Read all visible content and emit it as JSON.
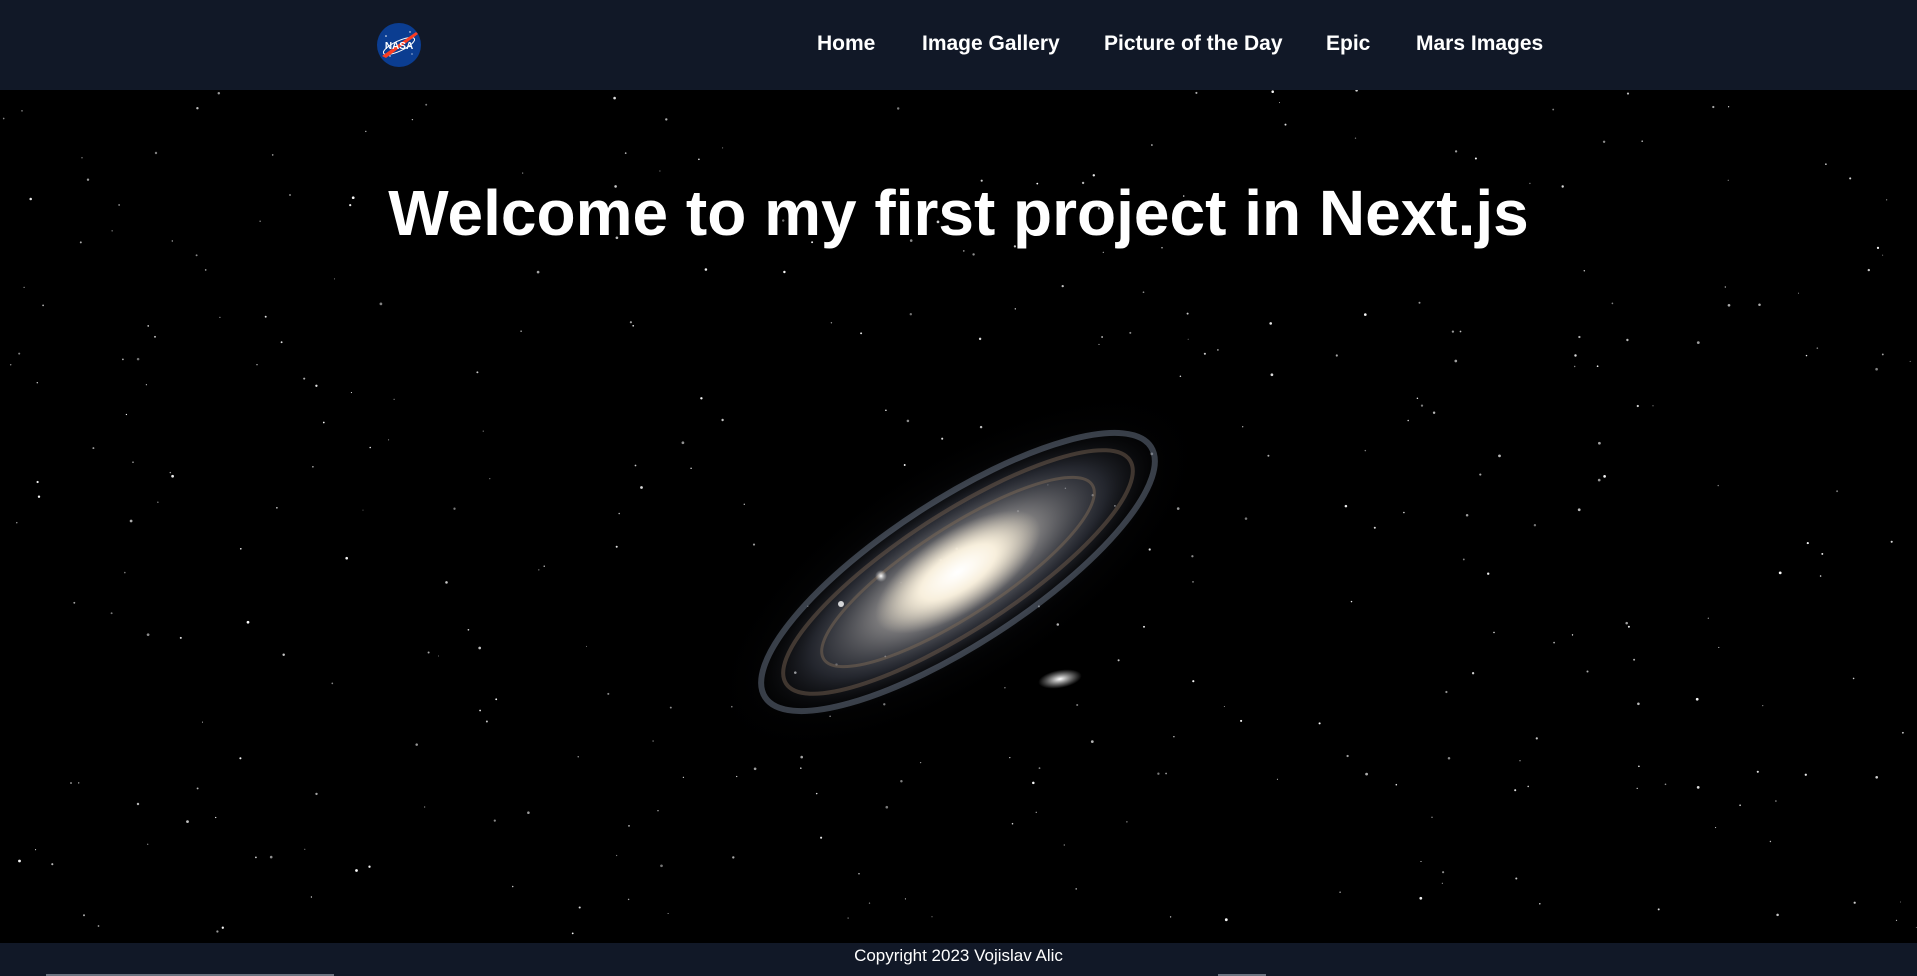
{
  "header": {
    "logo_text": "NASA",
    "nav": [
      {
        "label": "Home"
      },
      {
        "label": "Image Gallery"
      },
      {
        "label": "Picture of the Day"
      },
      {
        "label": "Epic"
      },
      {
        "label": "Mars Images"
      }
    ],
    "background_color": "#111827"
  },
  "main": {
    "headline": "Welcome to my first project in Next.js",
    "hero_image": "andromeda-galaxy",
    "background_color": "#000000"
  },
  "footer": {
    "copyright": "Copyright 2023 Vojislav Alic"
  }
}
